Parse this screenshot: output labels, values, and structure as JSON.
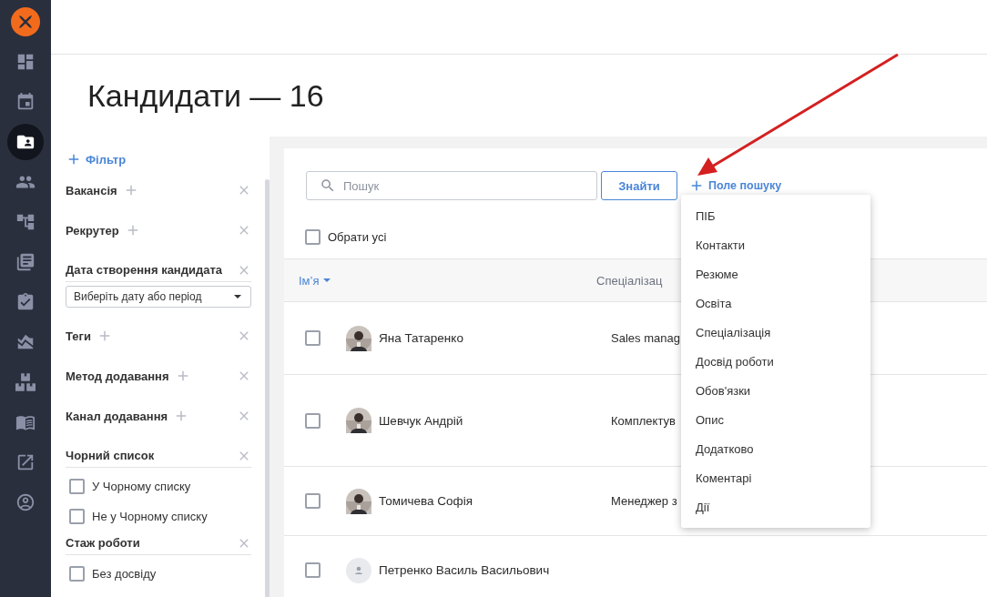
{
  "nav": [
    {
      "selected": false
    },
    {
      "selected": false
    },
    {
      "selected": true
    },
    {
      "selected": false
    },
    {
      "selected": false
    },
    {
      "selected": false
    },
    {
      "selected": false
    },
    {
      "selected": false
    },
    {
      "selected": false
    },
    {
      "selected": false
    },
    {
      "selected": false
    },
    {
      "selected": false
    }
  ],
  "title": "Кандидати — 16",
  "filter_panel": {
    "add_label": "Фільтр",
    "filters": [
      {
        "kind": "add",
        "label": "Вакансія"
      },
      {
        "kind": "add",
        "label": "Рекрутер"
      },
      {
        "kind": "date",
        "label": "Дата створення кандидата",
        "placeholder": "Виберіть дату або період"
      },
      {
        "kind": "add",
        "label": "Теги"
      },
      {
        "kind": "add",
        "label": "Метод додавання"
      },
      {
        "kind": "add",
        "label": "Канал додавання"
      },
      {
        "kind": "options",
        "label": "Чорний список",
        "options": [
          {
            "label": "У Чорному списку",
            "checked": false
          },
          {
            "label": "Не у Чорному списку",
            "checked": false
          }
        ]
      },
      {
        "kind": "options",
        "label": "Стаж роботи",
        "options": [
          {
            "label": "Без досвіду",
            "checked": false
          }
        ]
      }
    ]
  },
  "search": {
    "placeholder": "Пошук",
    "button": "Знайти",
    "add_field": "Поле пошуку"
  },
  "select_all": {
    "label": "Обрати усі",
    "checked": false
  },
  "table": {
    "columns": [
      "Ім’я",
      "Спеціалізац"
    ],
    "rows": [
      {
        "name": "Яна Татаренко",
        "specialization": "Sales manag",
        "checked": false
      },
      {
        "name": "Шевчук Андрій",
        "specialization": "Комплектув",
        "checked": false
      },
      {
        "name": "Томичева Софія",
        "specialization": "Менеджер з",
        "checked": false
      },
      {
        "name": "Петренко Василь Васильович",
        "checked": false,
        "kind": "placeholder"
      }
    ]
  },
  "field_menu": {
    "items": [
      "ПІБ",
      "Контакти",
      "Резюме",
      "Освіта",
      "Спеціалізація",
      "Досвід роботи",
      "Обов'язки",
      "Опис",
      "Додатково",
      "Коментарі",
      "Дії"
    ]
  }
}
